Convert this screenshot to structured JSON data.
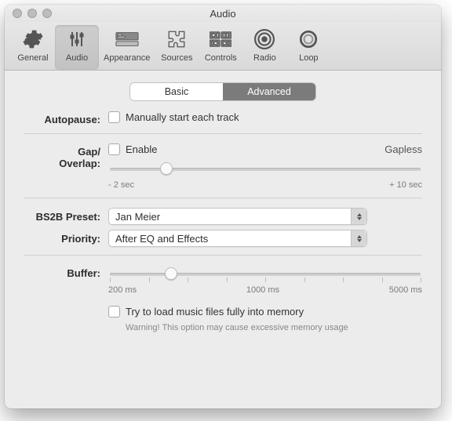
{
  "window": {
    "title": "Audio"
  },
  "toolbar": {
    "items": [
      {
        "label": "General"
      },
      {
        "label": "Audio"
      },
      {
        "label": "Appearance"
      },
      {
        "label": "Sources"
      },
      {
        "label": "Controls"
      },
      {
        "label": "Radio"
      },
      {
        "label": "Loop"
      }
    ]
  },
  "tabs": {
    "basic": "Basic",
    "advanced": "Advanced"
  },
  "autopause": {
    "label": "Autopause:",
    "checkbox": "Manually start each track"
  },
  "gap": {
    "label": "Gap/\nOverlap:",
    "enable": "Enable",
    "gapless": "Gapless",
    "left": "- 2 sec",
    "right": "+ 10 sec"
  },
  "bs2b": {
    "label": "BS2B Preset:",
    "value": "Jan Meier"
  },
  "priority": {
    "label": "Priority:",
    "value": "After EQ and Effects"
  },
  "buffer": {
    "label": "Buffer:",
    "min": "200 ms",
    "mid": "1000 ms",
    "max": "5000 ms",
    "memory_checkbox": "Try to load music files fully into memory",
    "warning": "Warning! This option may cause excessive memory usage"
  }
}
